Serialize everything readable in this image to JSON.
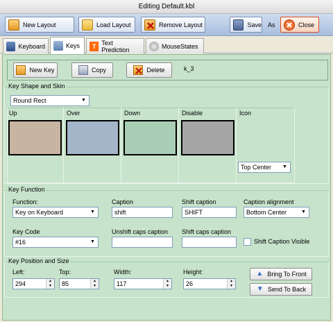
{
  "window": {
    "title": "Editing Default.kbl"
  },
  "toolbar": {
    "new_layout": "New Layout",
    "load_layout": "Load Layout",
    "remove_layout": "Remove Layout",
    "save": "Save",
    "save_as": "As",
    "close": "Close"
  },
  "tabs": [
    {
      "label": "Keyboard"
    },
    {
      "label": "Keys"
    },
    {
      "label": "Text Prediction"
    },
    {
      "label": "MouseStates"
    }
  ],
  "actions": {
    "new_key": "New Key",
    "copy": "Copy",
    "delete": "Delete",
    "key_id": "k_3"
  },
  "shape": {
    "group_label": "Key Shape and Skin",
    "shape_value": "Round Rect",
    "states": [
      {
        "label": "Up",
        "color": "#c8b4a2"
      },
      {
        "label": "Over",
        "color": "#a3b5c9"
      },
      {
        "label": "Down",
        "color": "#a9cdb5"
      },
      {
        "label": "Disable",
        "color": "#a6a6a6"
      }
    ],
    "icon_label": "Icon",
    "icon_position": "Top Center"
  },
  "function": {
    "group_label": "Key Function",
    "function_label": "Function:",
    "function_value": "Key on Keyboard",
    "caption_label": "Caption",
    "caption_value": "shift",
    "shift_caption_label": "Shift caption",
    "shift_caption_value": "SHIFT",
    "alignment_label": "Caption alignment",
    "alignment_value": "Bottom Center",
    "keycode_label": "Key Code",
    "keycode_value": "#16",
    "unshift_caps_label": "Unshift caps caption",
    "unshift_caps_value": "",
    "shift_caps_label": "Shift caps caption",
    "shift_caps_value": "",
    "shift_visible_label": "Shift Caption Visible"
  },
  "position": {
    "group_label": "Key Position and Size",
    "left_label": "Left:",
    "left_value": "294",
    "top_label": "Top:",
    "top_value": "85",
    "width_label": "Width:",
    "width_value": "117",
    "height_label": "Height:",
    "height_value": "26",
    "bring_front": "Bring To Front",
    "send_back": "Send To Back"
  }
}
